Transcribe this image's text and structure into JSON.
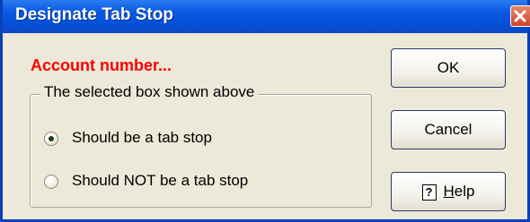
{
  "window": {
    "title": "Designate Tab Stop"
  },
  "field_name": "Account number...",
  "group": {
    "legend": "The selected box shown above",
    "options": [
      {
        "label": "Should be a tab stop",
        "selected": true
      },
      {
        "label": "Should NOT be a tab stop",
        "selected": false
      }
    ]
  },
  "buttons": {
    "ok": "OK",
    "cancel": "Cancel",
    "help_icon": "?",
    "help_mnemonic": "H",
    "help_rest": "elp"
  }
}
